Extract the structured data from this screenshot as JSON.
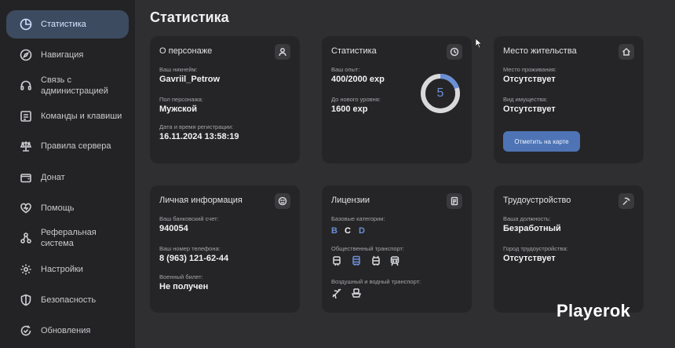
{
  "sidebar": {
    "items": [
      {
        "label": "Статистика",
        "icon": "pie-chart-icon",
        "active": true
      },
      {
        "label": "Навигация",
        "icon": "compass-icon"
      },
      {
        "label": "Связь с\nадминистрацией",
        "icon": "headset-icon"
      },
      {
        "label": "Команды и клавиши",
        "icon": "terminal-icon"
      },
      {
        "label": "Правила сервера",
        "icon": "scales-icon"
      },
      {
        "label": "Донат",
        "icon": "wallet-icon"
      },
      {
        "label": "Помощь",
        "icon": "heart-icon"
      },
      {
        "label": "Реферальная\nсистема",
        "icon": "network-icon"
      },
      {
        "label": "Настройки",
        "icon": "gear-icon"
      },
      {
        "label": "Безопасность",
        "icon": "shield-icon"
      },
      {
        "label": "Обновления",
        "icon": "update-icon"
      }
    ]
  },
  "main": {
    "title": "Статистика",
    "character": {
      "title": "О персонаже",
      "nickname_label": "Ваш никнейм:",
      "nickname": "Gavriil_Petrow",
      "gender_label": "Пол персонажа:",
      "gender": "Мужской",
      "reg_label": "Дата и время регистрации:",
      "reg": "16.11.2024 13:58:19"
    },
    "stats": {
      "title": "Статистика",
      "exp_label": "Ваш опыт:",
      "exp": "400/2000 exp",
      "next_label": "До нового уровня:",
      "next": "1600 exp",
      "level": "5",
      "progress": 0.2
    },
    "residence": {
      "title": "Место жительства",
      "place_label": "Место проживания:",
      "place": "Отсутствует",
      "property_label": "Вид имущества:",
      "property": "Отсутствует",
      "map_button": "Отметить на карте"
    },
    "personal": {
      "title": "Личная информация",
      "bank_label": "Ваш банковский счет:",
      "bank": "940054",
      "phone_label": "Ваш номер телефона:",
      "phone": "8 (963) 121-62-44",
      "military_label": "Военный билет:",
      "military": "Не получен"
    },
    "licenses": {
      "title": "Лицензии",
      "base_label": "Базовые категории:",
      "categories": [
        {
          "label": "B",
          "color": "#6b8fd6"
        },
        {
          "label": "C",
          "color": "#f3f3f4"
        },
        {
          "label": "D",
          "color": "#6b8fd6"
        }
      ],
      "public_label": "Общественный транспорт:",
      "air_label": "Воздушный и водный транспорт:"
    },
    "employment": {
      "title": "Трудоустройство",
      "position_label": "Ваша должность:",
      "position": "Безработный",
      "city_label": "Город трудоустройства:",
      "city": "Отсутствует"
    }
  },
  "watermark": "Playerok",
  "colors": {
    "accent": "#6b8fd6",
    "button": "#4e74b5",
    "card": "#252527",
    "background": "#2f2f31",
    "sidebar": "#232325"
  }
}
